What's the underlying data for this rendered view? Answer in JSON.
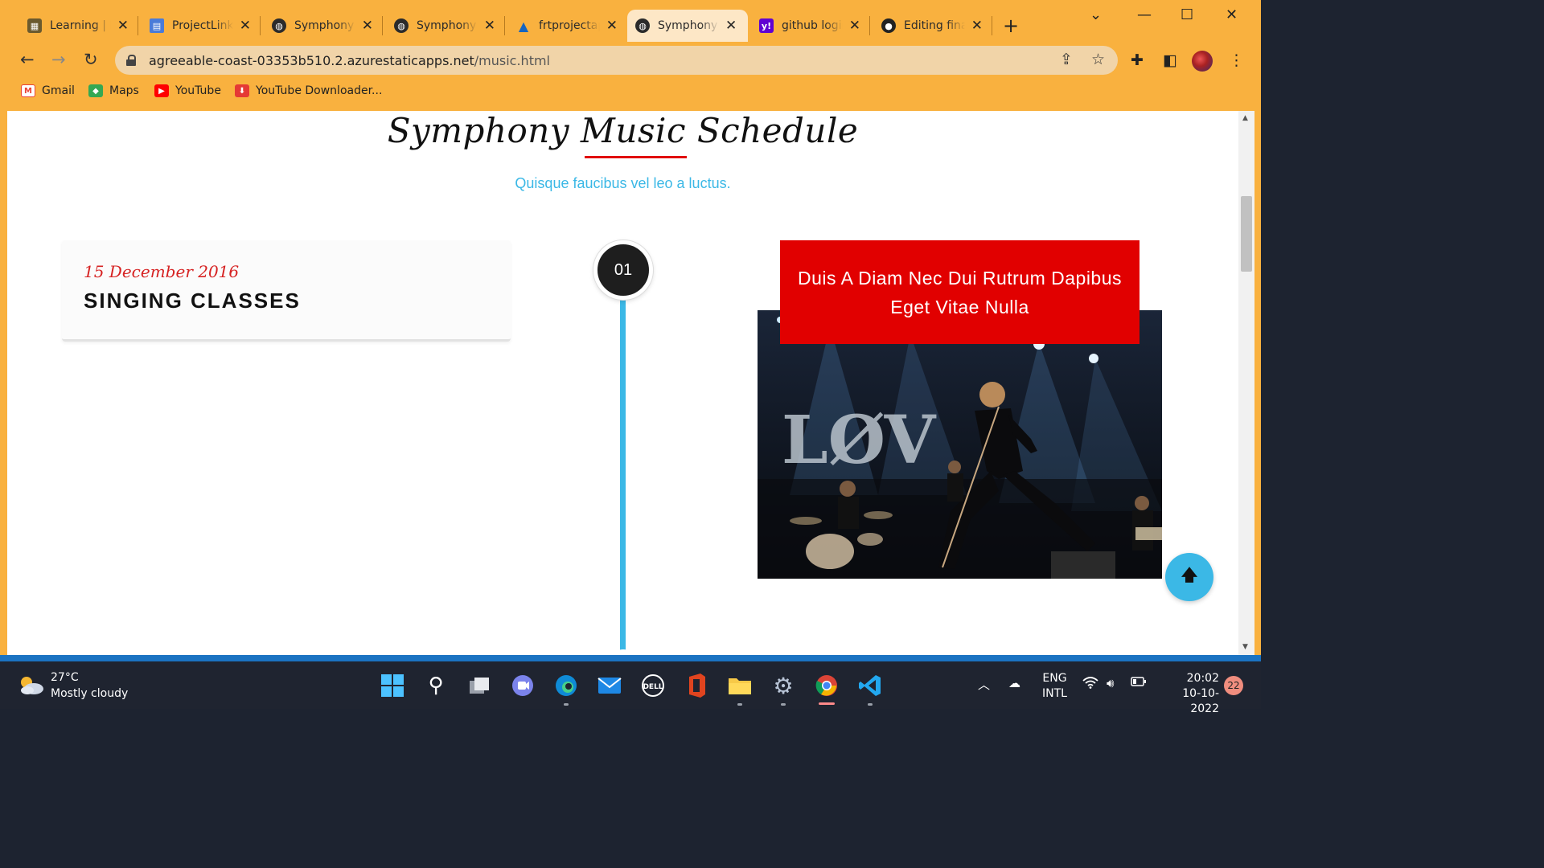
{
  "browser": {
    "tabs": [
      {
        "title": "Learning | Fu",
        "icon": "learning-favicon",
        "color": "#6b5a2e"
      },
      {
        "title": "ProjectLink-Fr",
        "icon": "document-favicon",
        "color": "#4a7bd8"
      },
      {
        "title": "Symphony a",
        "icon": "globe-favicon",
        "color": "#2b2b2b"
      },
      {
        "title": "Symphony a",
        "icon": "globe-favicon",
        "color": "#2b2b2b"
      },
      {
        "title": "frtprojectapp",
        "icon": "azure-favicon",
        "color": "#1565c0"
      },
      {
        "title": "Symphony a",
        "icon": "globe-favicon",
        "color": "#2b2b2b",
        "active": true
      },
      {
        "title": "github login",
        "icon": "yahoo-favicon",
        "color": "#6001d2"
      },
      {
        "title": "Editing final",
        "icon": "github-favicon",
        "color": "#222222"
      }
    ],
    "url_host": "agreeable-coast-03353b510.2.azurestaticapps.net",
    "url_path": "/music.html",
    "bookmarks": [
      {
        "label": "Gmail",
        "icon": "gmail-icon"
      },
      {
        "label": "Maps",
        "icon": "maps-icon"
      },
      {
        "label": "YouTube",
        "icon": "youtube-icon"
      },
      {
        "label": "YouTube Downloader...",
        "icon": "download-icon"
      }
    ]
  },
  "page": {
    "title": "Symphony Music Schedule",
    "subtitle": "Quisque faucibus vel leo a luctus.",
    "events": [
      {
        "number": "01",
        "date": "15 December 2016",
        "name": "SINGING CLASSES",
        "caption": "Duis A Diam Nec Dui Rutrum Dapibus Eget Vitae Nulla",
        "photo_banner": "LØV"
      }
    ],
    "back_to_top_icon": "arrow-up-icon"
  },
  "colors": {
    "accent_red": "#e10000",
    "accent_blue": "#3bb8e6",
    "chrome_orange": "#f9b13f"
  },
  "taskbar": {
    "weather_temp": "27°C",
    "weather_desc": "Mostly cloudy",
    "lang_line1": "ENG",
    "lang_line2": "INTL",
    "time": "20:02",
    "date": "10-10-2022",
    "notifications": "22"
  }
}
